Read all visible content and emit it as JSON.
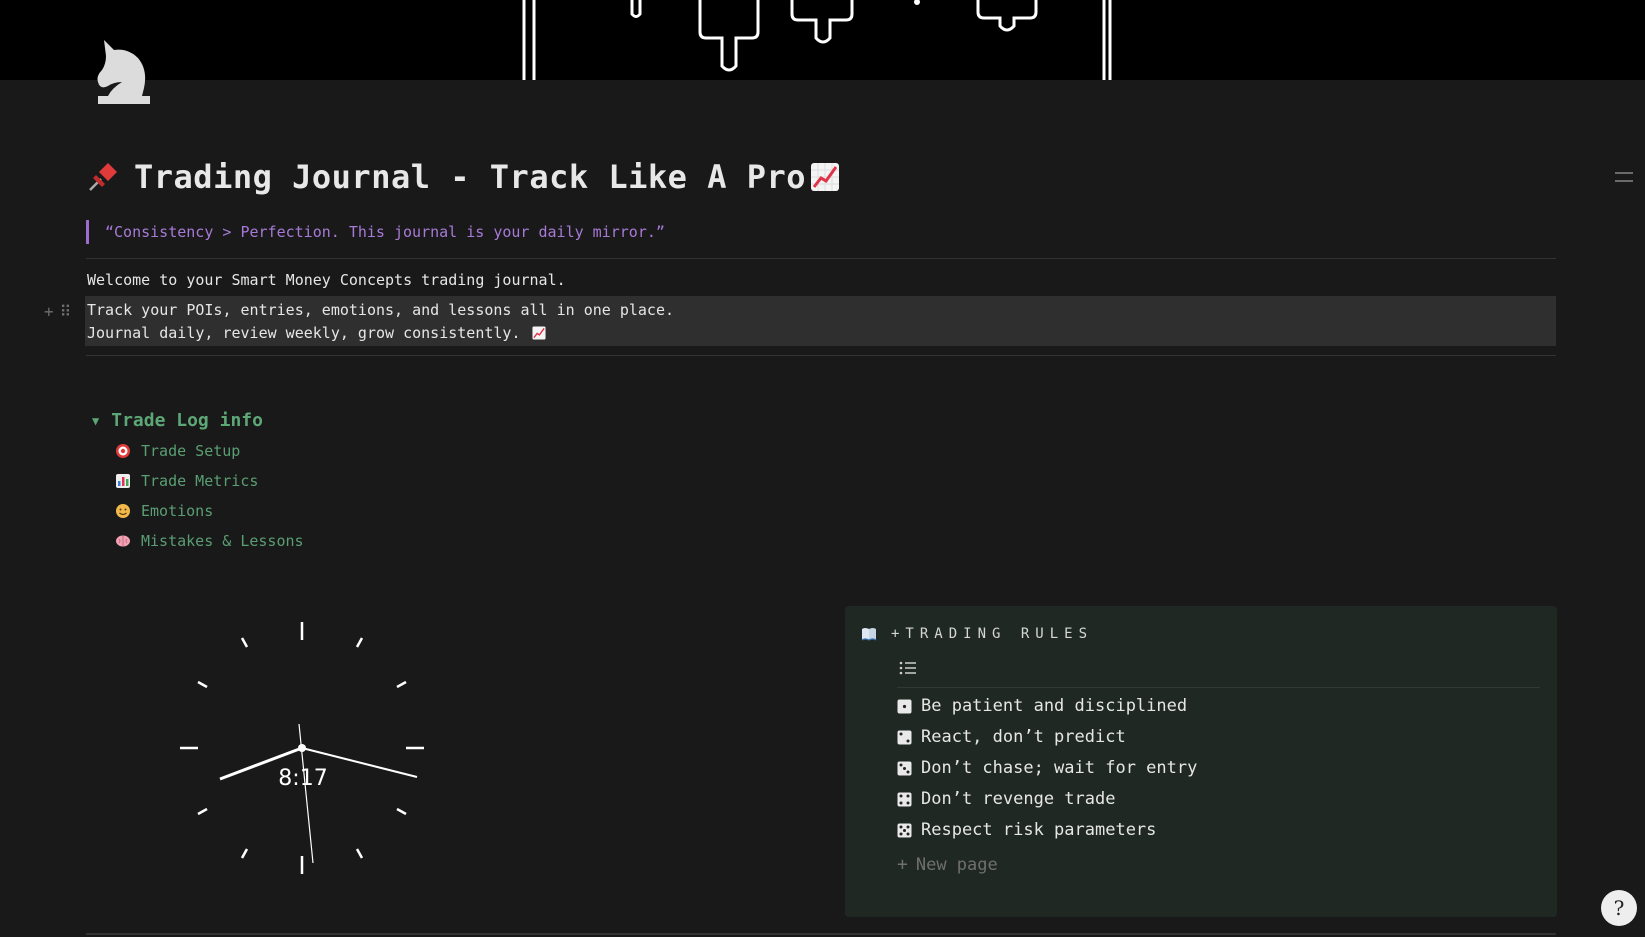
{
  "page": {
    "title": "Trading Journal - Track Like A Pro",
    "title_icon": "pushpin-icon",
    "title_suffix_icon": "chart-increasing-icon",
    "page_icon": "chess-knight-icon",
    "quote": "“Consistency > Perfection. This journal is your daily mirror.”",
    "welcome": "Welcome to your Smart Money Concepts trading journal.",
    "track_line": "Track your POIs, entries, emotions, and lessons all in one place.",
    "journal_line": "Journal daily, review weekly, grow consistently.",
    "journal_line_icon": "chart-increasing-icon"
  },
  "toggle": {
    "label": "Trade Log info",
    "items": [
      {
        "icon": "target-icon",
        "label": "Trade Setup"
      },
      {
        "icon": "bar-chart-icon",
        "label": "Trade Metrics"
      },
      {
        "icon": "face-icon",
        "label": "Emotions"
      },
      {
        "icon": "brain-icon",
        "label": "Mistakes & Lessons"
      }
    ]
  },
  "clock": {
    "time": "8:17"
  },
  "rules": {
    "title": "+TRADING RULES",
    "items": [
      {
        "icon": "die-one-icon",
        "label": "Be patient and disciplined"
      },
      {
        "icon": "die-two-icon",
        "label": "React, don’t predict"
      },
      {
        "icon": "die-three-icon",
        "label": "Don’t chase; wait for entry"
      },
      {
        "icon": "die-four-icon",
        "label": "Don’t revenge trade"
      },
      {
        "icon": "die-five-icon",
        "label": "Respect risk parameters"
      }
    ],
    "new_page": "New page"
  },
  "colors": {
    "background": "#191919",
    "quote": "#a77ad7",
    "toggle": "#5da776",
    "rules_bg": "#202824"
  }
}
